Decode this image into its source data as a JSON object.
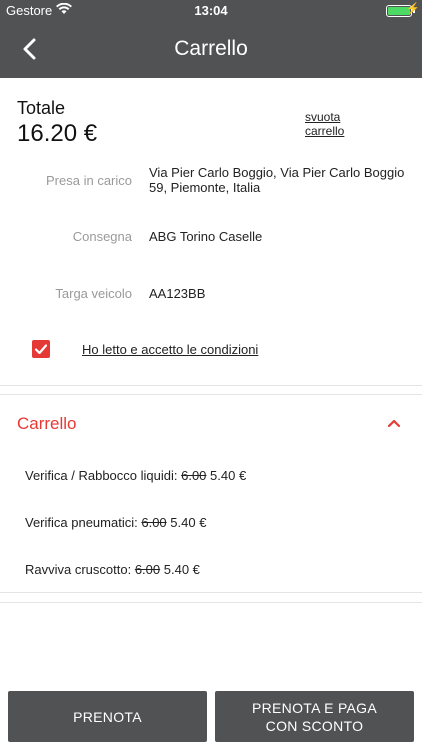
{
  "status_bar": {
    "carrier": "Gestore",
    "time": "13:04"
  },
  "nav": {
    "title": "Carrello"
  },
  "summary": {
    "total_label": "Totale",
    "total_value": "16.20 €",
    "clear_cart_link": "svuota carrello"
  },
  "details": [
    {
      "label": "Presa in carico",
      "value": "Via Pier Carlo Boggio, Via Pier Carlo Boggio 59, Piemonte, Italia"
    },
    {
      "label": "Consegna",
      "value": "ABG Torino Caselle"
    },
    {
      "label": "Targa veicolo",
      "value": "AA123BB"
    }
  ],
  "terms": {
    "label": "Ho letto e accetto le condizioni",
    "checked": true
  },
  "cart": {
    "title": "Carrello",
    "items": [
      {
        "name": "Verifica / Rabbocco liquidi:",
        "old_price": "6.00",
        "price": "5.40 €"
      },
      {
        "name": "Verifica pneumatici:",
        "old_price": "6.00",
        "price": "5.40 €"
      },
      {
        "name": "Ravviva cruscotto:",
        "old_price": "6.00",
        "price": "5.40 €"
      }
    ]
  },
  "buttons": {
    "book": "PRENOTA",
    "book_pay": "PRENOTA E PAGA CON SCONTO"
  },
  "colors": {
    "bar": "#515254",
    "accent": "#e53935"
  }
}
